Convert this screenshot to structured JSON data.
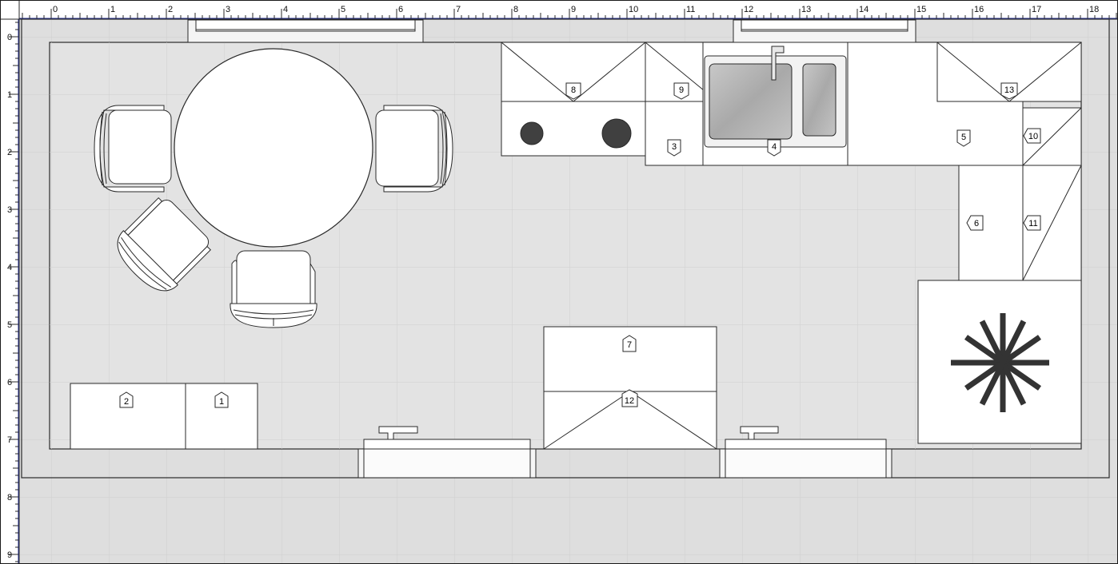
{
  "ruler": {
    "top_labels": [
      "0",
      "1",
      "2",
      "3",
      "4",
      "5",
      "6",
      "7",
      "8",
      "9",
      "10",
      "11",
      "12",
      "13",
      "14",
      "15",
      "16",
      "17",
      "18"
    ],
    "left_labels": [
      "0",
      "1",
      "2",
      "3",
      "4",
      "5",
      "6",
      "7",
      "8",
      "9"
    ]
  },
  "colors": {
    "background": "#dedede",
    "floor": "#e6e6e6",
    "grid": "#cfcfcf",
    "item_fill": "#ffffff",
    "outline": "#2a2a2a",
    "sink_fill": "#b9b9b9",
    "burner": "#404040",
    "accent_blue": "#1f2a8a"
  },
  "tags": {
    "t1": "1",
    "t2": "2",
    "t3": "3",
    "t4": "4",
    "t5": "5",
    "t6": "6",
    "t7": "7",
    "t8": "8",
    "t9": "9",
    "t10": "10",
    "t11": "11",
    "t12": "12",
    "t13": "13"
  },
  "objects": {
    "dining_table": "round-table",
    "chairs": 4,
    "fan": "ceiling-fan-icon",
    "sink": "double-sink",
    "cooktop": "two-burner-cooktop"
  }
}
